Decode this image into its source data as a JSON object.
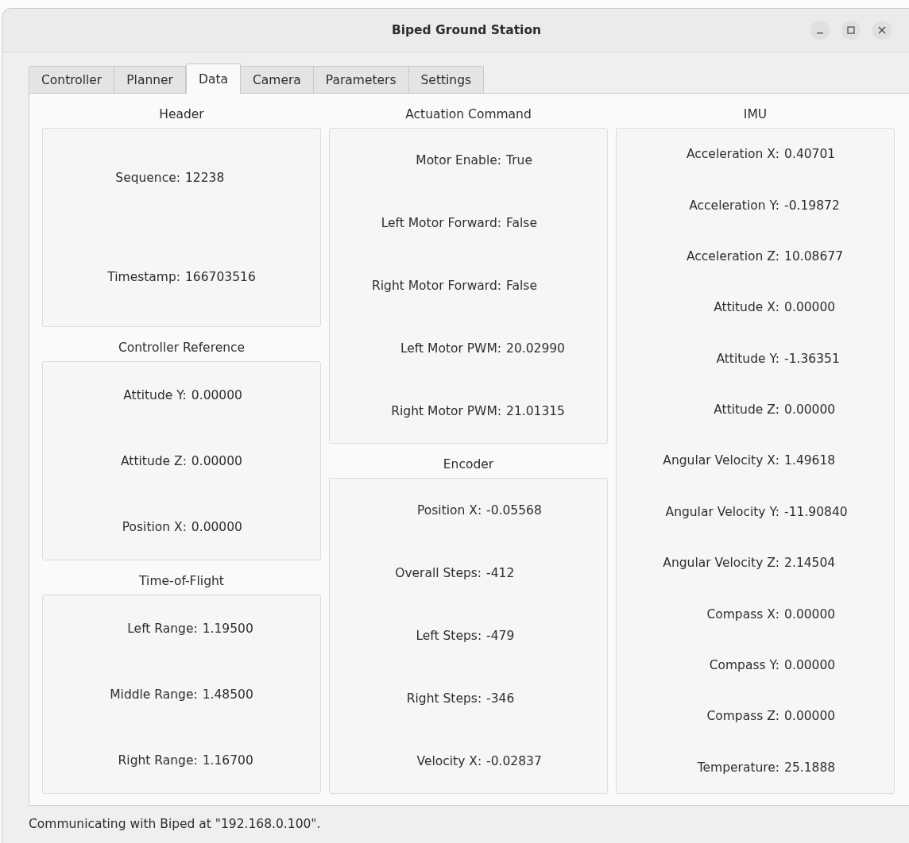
{
  "window": {
    "title": "Biped Ground Station"
  },
  "tabs": [
    {
      "label": "Controller",
      "selected": false
    },
    {
      "label": "Planner",
      "selected": false
    },
    {
      "label": "Data",
      "selected": true
    },
    {
      "label": "Camera",
      "selected": false
    },
    {
      "label": "Parameters",
      "selected": false
    },
    {
      "label": "Settings",
      "selected": false
    }
  ],
  "columns": [
    {
      "groups": [
        {
          "title": "Header",
          "fields": [
            {
              "label": "Sequence:",
              "value": "12238"
            },
            {
              "label": "Timestamp:",
              "value": "166703516"
            }
          ]
        },
        {
          "title": "Controller Reference",
          "fields": [
            {
              "label": "Attitude Y:",
              "value": "0.00000"
            },
            {
              "label": "Attitude Z:",
              "value": "0.00000"
            },
            {
              "label": "Position X:",
              "value": "0.00000"
            }
          ]
        },
        {
          "title": "Time-of-Flight",
          "fields": [
            {
              "label": "Left Range:",
              "value": "1.19500"
            },
            {
              "label": "Middle Range:",
              "value": "1.48500"
            },
            {
              "label": "Right Range:",
              "value": "1.16700"
            }
          ]
        }
      ]
    },
    {
      "groups": [
        {
          "title": "Actuation Command",
          "fields": [
            {
              "label": "Motor Enable:",
              "value": "True"
            },
            {
              "label": "Left Motor Forward:",
              "value": "False"
            },
            {
              "label": "Right Motor Forward:",
              "value": "False"
            },
            {
              "label": "Left Motor PWM:",
              "value": "20.02990"
            },
            {
              "label": "Right Motor PWM:",
              "value": "21.01315"
            }
          ]
        },
        {
          "title": "Encoder",
          "fields": [
            {
              "label": "Position X:",
              "value": "-0.05568"
            },
            {
              "label": "Overall Steps:",
              "value": "-412"
            },
            {
              "label": "Left Steps:",
              "value": "-479"
            },
            {
              "label": "Right Steps:",
              "value": "-346"
            },
            {
              "label": "Velocity X:",
              "value": "-0.02837"
            }
          ]
        }
      ]
    },
    {
      "groups": [
        {
          "title": "IMU",
          "fields": [
            {
              "label": "Acceleration X:",
              "value": "0.40701"
            },
            {
              "label": "Acceleration Y:",
              "value": "-0.19872"
            },
            {
              "label": "Acceleration Z:",
              "value": "10.08677"
            },
            {
              "label": "Attitude X:",
              "value": "0.00000"
            },
            {
              "label": "Attitude Y:",
              "value": "-1.36351"
            },
            {
              "label": "Attitude Z:",
              "value": "0.00000"
            },
            {
              "label": "Angular Velocity X:",
              "value": "1.49618"
            },
            {
              "label": "Angular Velocity Y:",
              "value": "-11.90840"
            },
            {
              "label": "Angular Velocity Z:",
              "value": "2.14504"
            },
            {
              "label": "Compass X:",
              "value": "0.00000"
            },
            {
              "label": "Compass Y:",
              "value": "0.00000"
            },
            {
              "label": "Compass Z:",
              "value": "0.00000"
            },
            {
              "label": "Temperature:",
              "value": "25.1888"
            }
          ]
        }
      ]
    }
  ],
  "status_bar": {
    "text": "Communicating with Biped at \"192.168.0.100\"."
  }
}
